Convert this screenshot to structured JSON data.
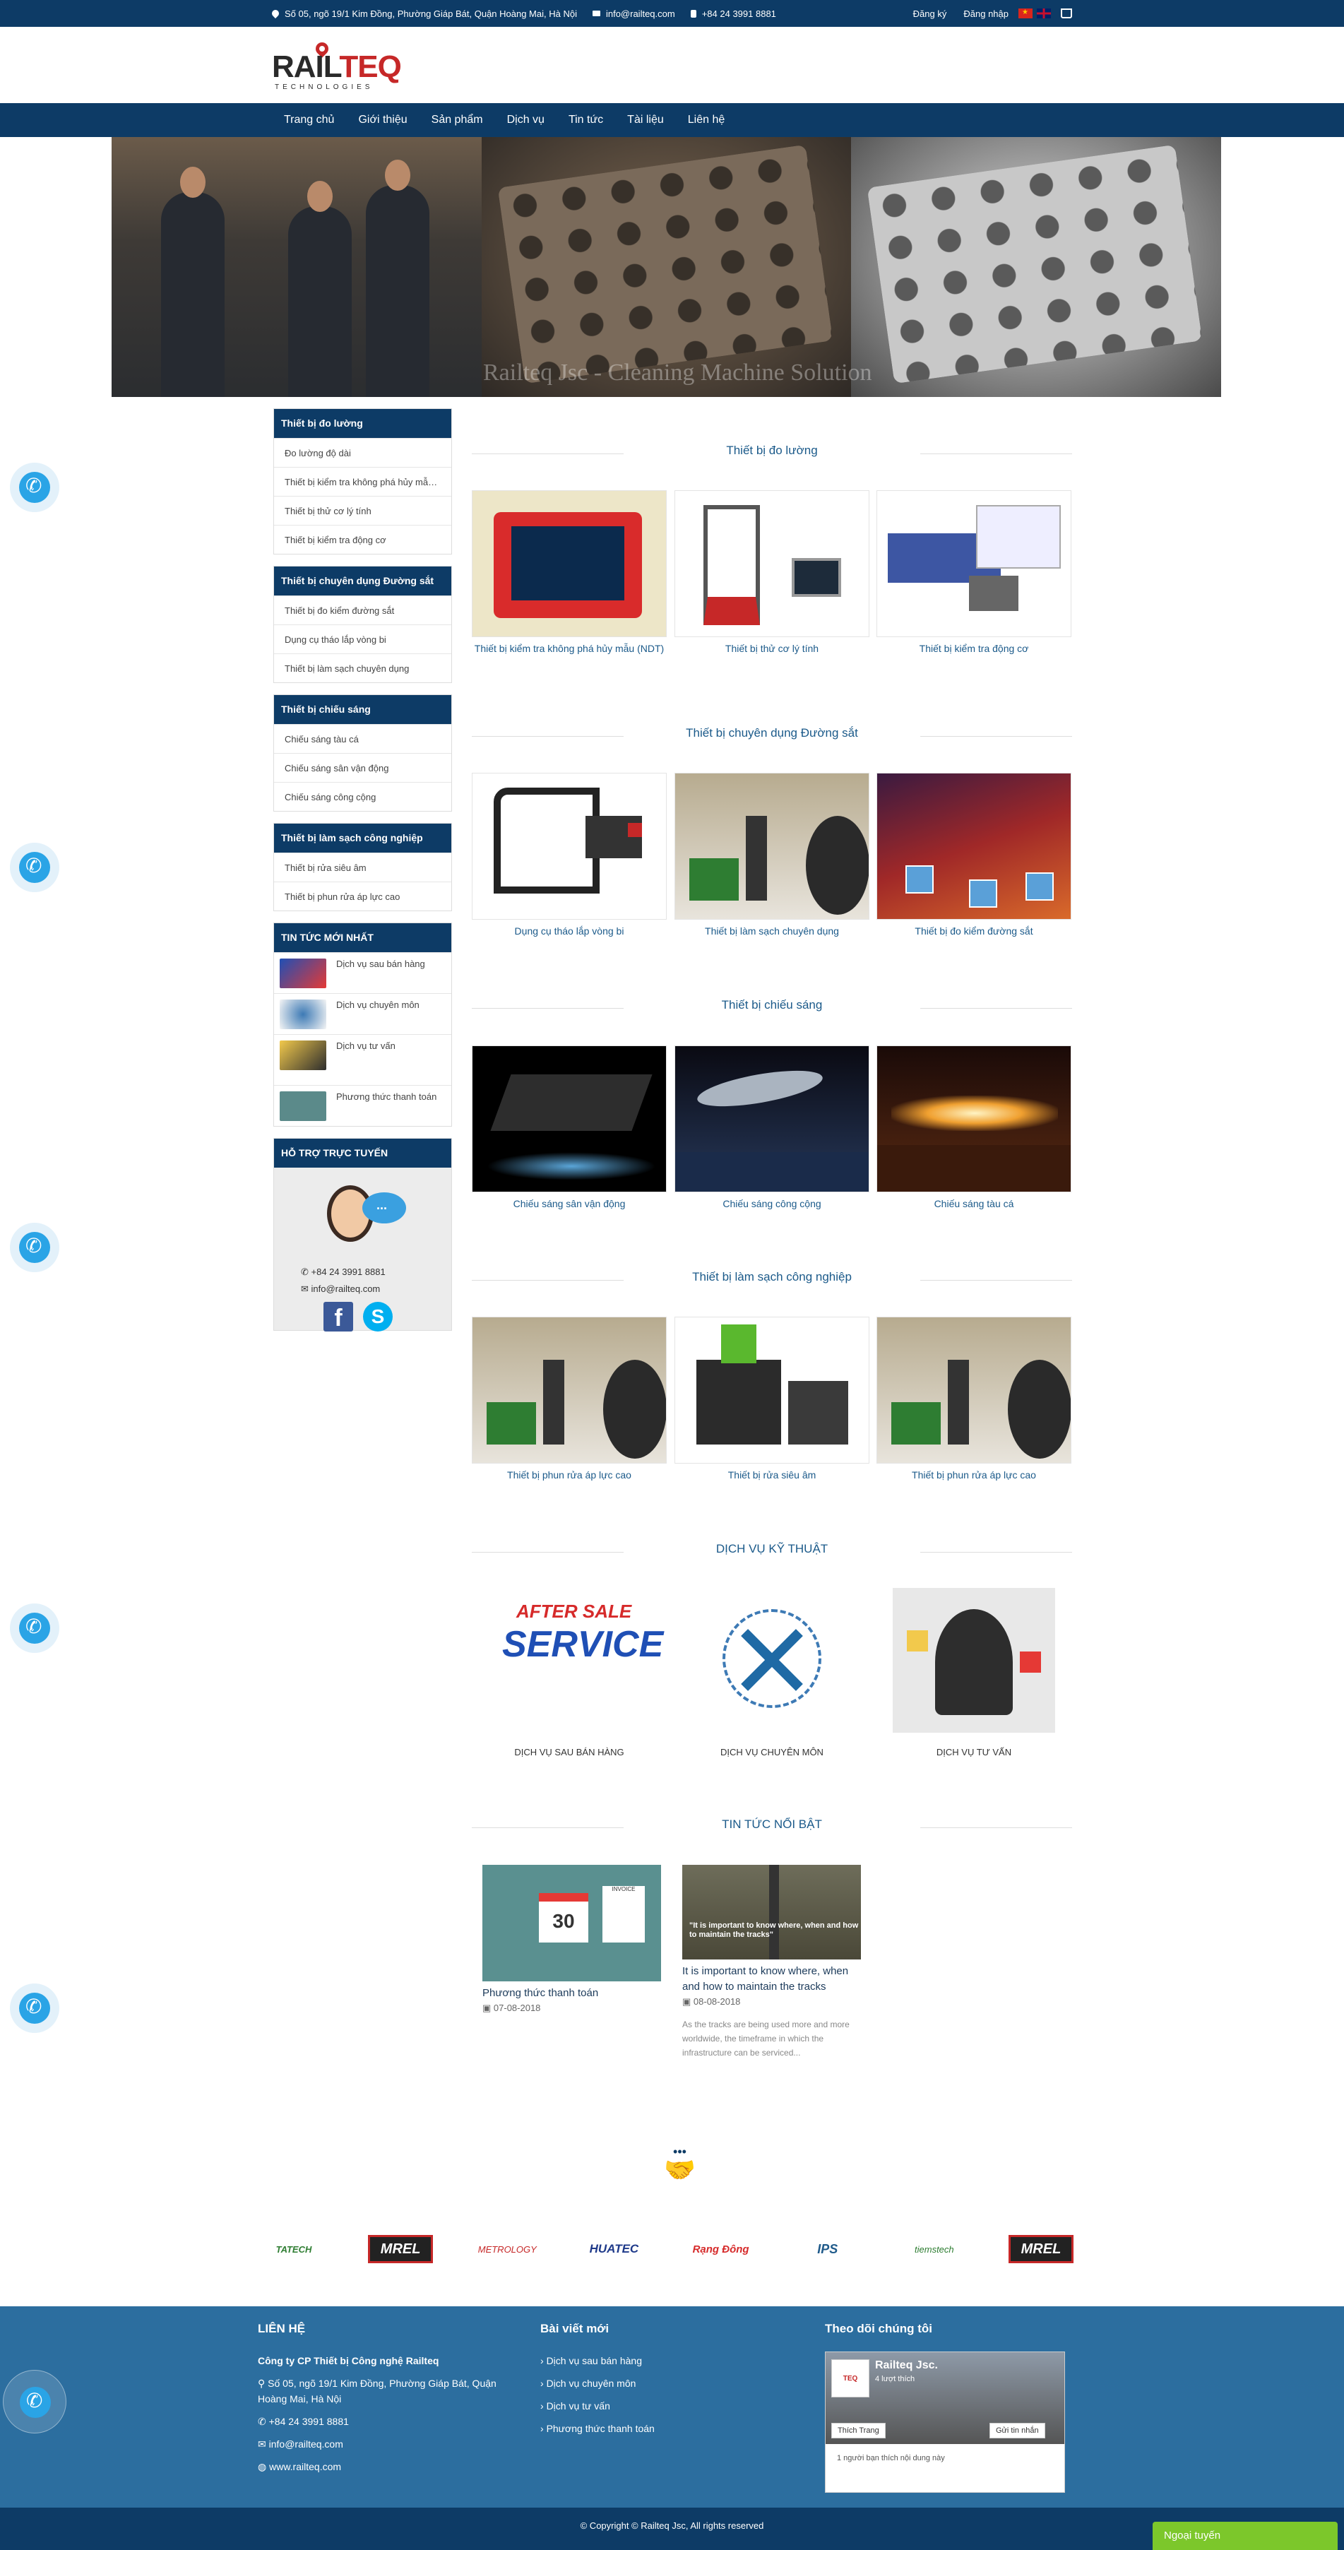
{
  "topbar": {
    "address": "Số 05, ngõ 19/1 Kim Đồng, Phường Giáp Bát, Quận Hoàng Mai, Hà Nội",
    "email": "info@railteq.com",
    "phone": "+84 24 3991 8881",
    "register": "Đăng ký",
    "login": "Đăng nhập"
  },
  "logo": {
    "rail": "RAIL",
    "teq": "TEQ",
    "sub": "TECHNOLOGIES"
  },
  "nav": [
    "Trang chủ",
    "Giới thiệu",
    "Sản phẩm",
    "Dịch vụ",
    "Tin tức",
    "Tài liệu",
    "Liên hệ"
  ],
  "banner": {
    "caption": "Railteq Jsc - Cleaning Machine Solution"
  },
  "sidebar": {
    "categories": [
      {
        "title": "Thiết bị đo lường",
        "items": [
          "Đo lường độ dài",
          "Thiết bị kiểm tra không phá hủy mẫu (NDT)",
          "Thiết bị thử cơ lý tính",
          "Thiết bị kiểm tra động cơ"
        ]
      },
      {
        "title": "Thiết bị chuyên dụng Đường sắt",
        "items": [
          "Thiết bị đo kiểm đường sắt",
          "Dụng cụ tháo lắp vòng bi",
          "Thiết bị làm sạch chuyên dụng"
        ]
      },
      {
        "title": "Thiết bị chiếu sáng",
        "items": [
          "Chiếu sáng tàu cá",
          "Chiếu sáng sân vận động",
          "Chiếu sáng công cộng"
        ]
      },
      {
        "title": "Thiết bị làm sạch công nghiệp",
        "items": [
          "Thiết bị rửa siêu âm",
          "Thiết bị phun rửa áp lực cao"
        ]
      }
    ],
    "news_title": "TIN TỨC MỚI NHẤT",
    "news": [
      "Dịch vụ sau bán hàng",
      "Dịch vụ chuyên môn",
      "Dịch vụ tư vấn",
      "Phương thức thanh toán"
    ],
    "support_title": "HỖ TRỢ TRỰC TUYẾN",
    "support_phone": "+84 24 3991 8881",
    "support_email": "info@railteq.com"
  },
  "sections": [
    {
      "title": "Thiết bị đo lường",
      "products": [
        "Thiết bị kiểm tra không phá hủy mẫu (NDT)",
        "Thiết bị thử cơ lý tính",
        "Thiết bị kiểm tra động cơ"
      ]
    },
    {
      "title": "Thiết bị chuyên dụng Đường sắt",
      "products": [
        "Dụng cụ tháo lắp vòng bi",
        "Thiết bị làm sạch chuyên dụng",
        "Thiết bị đo kiểm đường sắt"
      ]
    },
    {
      "title": "Thiết bị chiếu sáng",
      "products": [
        "Chiếu sáng sân vận động",
        "Chiếu sáng công cộng",
        "Chiếu sáng tàu cá"
      ]
    },
    {
      "title": "Thiết bị làm sạch công nghiệp",
      "products": [
        "Thiết bị phun rửa áp lực cao",
        "Thiết bị rửa siêu âm",
        "Thiết bị phun rửa áp lực cao"
      ]
    }
  ],
  "services": {
    "title": "DỊCH VỤ KỸ THUẬT",
    "items": [
      "DỊCH VỤ SAU BÁN HÀNG",
      "DỊCH VỤ CHUYÊN MÔN",
      "DỊCH VỤ TƯ VẤN"
    ],
    "after_sale_top": "AFTER SALE",
    "after_sale_main": "SERVICE"
  },
  "featured": {
    "title": "TIN TỨC NỔI BẬT",
    "items": [
      {
        "title": "Phương thức thanh toán",
        "date": "07-08-2018",
        "calendar_day": "30",
        "invoice": "INVOICE"
      },
      {
        "title": "It is important to know where, when and how to maintain the tracks",
        "date": "08-08-2018",
        "excerpt": "As the tracks are being used more and more worldwide, the timeframe in which the infrastructure can be serviced...",
        "overlay": "\"It is important to know where, when and how to maintain the tracks\""
      }
    ]
  },
  "partners": [
    "TATECH",
    "MREL",
    "METROLOGY",
    "HUATEC",
    "Rạng Đông",
    "IPS",
    "tiemstech",
    "MREL"
  ],
  "footer": {
    "contact_title": "LIÊN HỆ",
    "company": "Công ty CP Thiết bị Công nghệ Railteq",
    "address": "Số 05, ngõ 19/1 Kim Đồng, Phường Giáp Bát, Quận Hoàng Mai, Hà Nội",
    "phone": "+84 24 3991 8881",
    "email": "info@railteq.com",
    "website": "www.railteq.com",
    "posts_title": "Bài viết mới",
    "posts": [
      "Dịch vụ sau bán hàng",
      "Dịch vụ chuyên môn",
      "Dịch vụ tư vấn",
      "Phương thức thanh toán"
    ],
    "follow_title": "Theo dõi chúng tôi",
    "fb_page": "Railteq Jsc.",
    "fb_likes": "4 lượt thích",
    "fb_like": "Thích Trang",
    "fb_send": "Gửi tin nhắn",
    "fb_friends": "1 người bạn thích nội dung này",
    "copyright": "© Copyright © Railteq Jsc, All rights reserved",
    "online": "Ngoại tuyến"
  },
  "colors": {
    "primary": "#0d3b66",
    "footer": "#2c6e9f",
    "accent": "#2aa4e6",
    "online": "#7cc72b"
  }
}
